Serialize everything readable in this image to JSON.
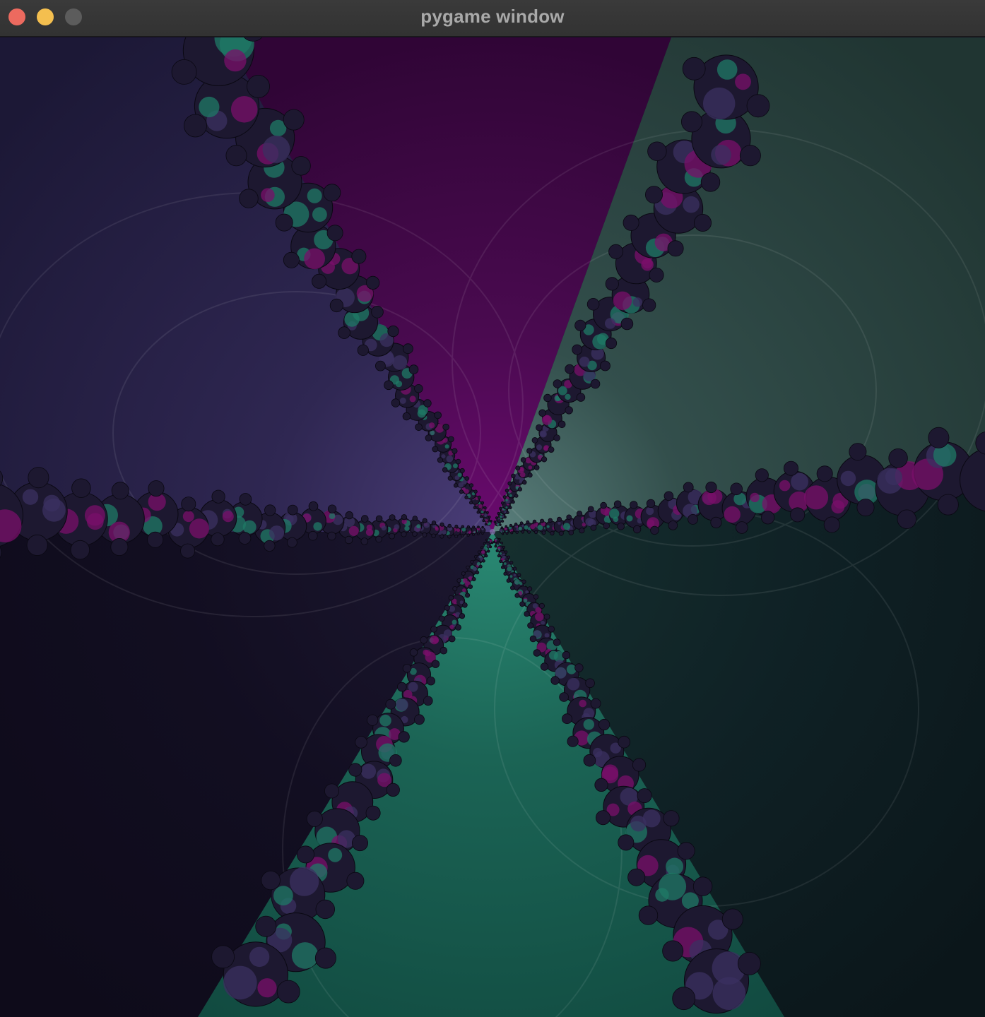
{
  "window": {
    "title": "pygame window"
  },
  "traffic_lights": {
    "close_color": "#ec6a5f",
    "minimize_color": "#f4bf4f",
    "maximize_color": "#5c5c5c"
  },
  "fractal": {
    "kind": "newton-style basin fractal with six radial wedges",
    "wedges": [
      {
        "position": "top",
        "color": "#4a0b4f"
      },
      {
        "position": "upper-right",
        "color": "#2d4b48"
      },
      {
        "position": "lower-right",
        "color": "#0e1f24"
      },
      {
        "position": "bottom",
        "color": "#1c6a5c"
      },
      {
        "position": "lower-left",
        "color": "#130f22"
      },
      {
        "position": "upper-left",
        "color": "#2e2650"
      }
    ],
    "boundary_colors": [
      "#1d1830",
      "#7a0f6a",
      "#1f7a66",
      "#3b3060"
    ]
  }
}
